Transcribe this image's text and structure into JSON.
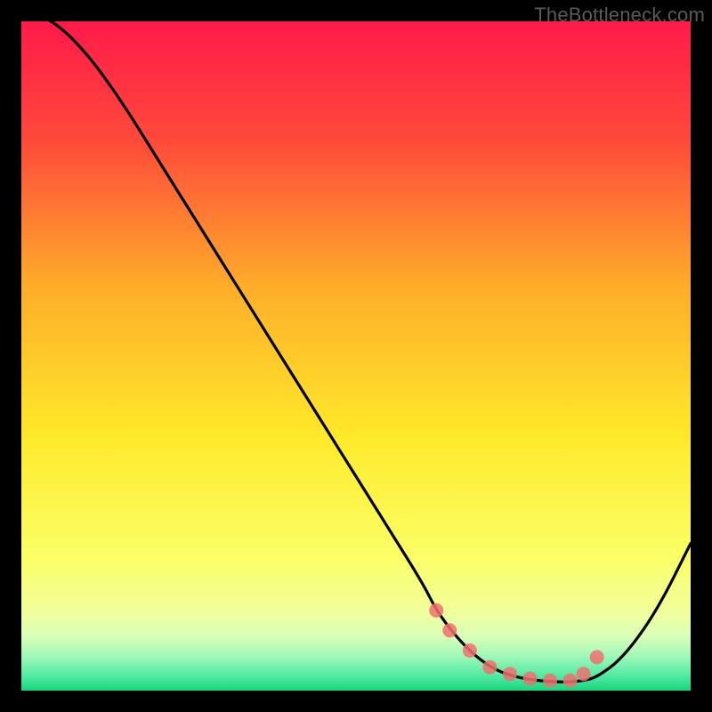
{
  "watermark": "TheBottleneck.com",
  "colors": {
    "gradient_top": "#ff1a4a",
    "gradient_mid1": "#ff7a2a",
    "gradient_mid2": "#ffd82a",
    "gradient_mid3": "#f9ff66",
    "gradient_bottom_band1": "#e6ffb0",
    "gradient_bottom_band2": "#9cf7b8",
    "gradient_bottom_band3": "#2ce28b",
    "curve": "#000000",
    "dot": "#f07070"
  },
  "chart_data": {
    "type": "line",
    "title": "",
    "xlabel": "",
    "ylabel": "",
    "xlim": [
      0,
      100
    ],
    "ylim": [
      0,
      100
    ],
    "x": [
      0,
      5,
      10,
      15,
      20,
      25,
      30,
      35,
      40,
      45,
      50,
      55,
      60,
      62,
      65,
      68,
      71,
      74,
      77,
      80,
      82,
      84,
      86,
      90,
      95,
      100
    ],
    "values": [
      102,
      100,
      95,
      88,
      80,
      72,
      64,
      56,
      48,
      40,
      32,
      24,
      16,
      12,
      8,
      5,
      3,
      2,
      1.5,
      1.3,
      1.3,
      1.5,
      2,
      5,
      12,
      22
    ],
    "markers_x": [
      62,
      64,
      67,
      70,
      73,
      76,
      79,
      82,
      84,
      86
    ],
    "markers_y": [
      12,
      9,
      6,
      3.5,
      2.5,
      1.8,
      1.5,
      1.5,
      2.5,
      5
    ]
  }
}
